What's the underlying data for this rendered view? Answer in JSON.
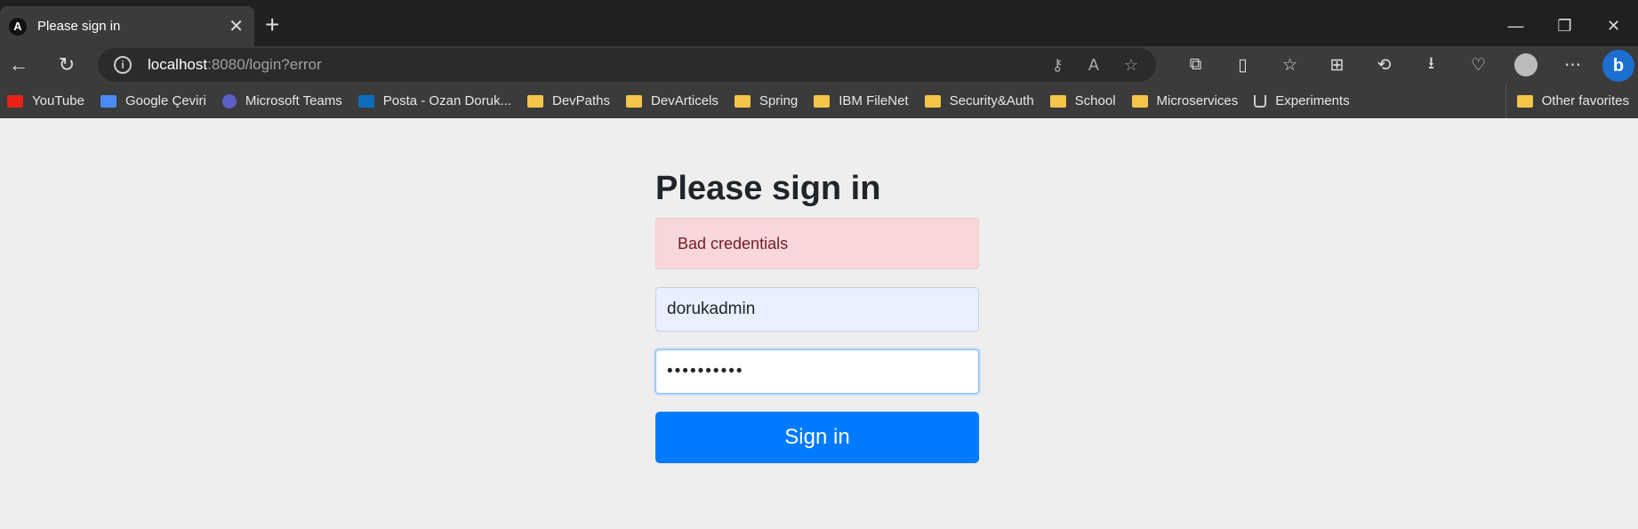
{
  "browser": {
    "tab_title": "Please sign in",
    "tab_favicon": "A",
    "new_tab": "+",
    "close_tab": "✕",
    "window_controls": [
      "—",
      "❐",
      "✕"
    ],
    "url_host": "localhost",
    "url_rest": ":8080/login?error",
    "bookmarks": [
      {
        "label": "YouTube",
        "icon": "youtube-icon"
      },
      {
        "label": "Google Çeviri",
        "icon": "google-translate-icon"
      },
      {
        "label": "Microsoft Teams",
        "icon": "teams-icon"
      },
      {
        "label": "Posta - Ozan Doruk...",
        "icon": "outlook-icon"
      },
      {
        "label": "DevPaths",
        "icon": "folder-icon"
      },
      {
        "label": "DevArticels",
        "icon": "folder-icon"
      },
      {
        "label": "Spring",
        "icon": "folder-icon"
      },
      {
        "label": "IBM FileNet",
        "icon": "folder-icon"
      },
      {
        "label": "Security&Auth",
        "icon": "folder-icon"
      },
      {
        "label": "School",
        "icon": "folder-icon"
      },
      {
        "label": "Microservices",
        "icon": "folder-icon"
      },
      {
        "label": "Experiments",
        "icon": "flask-icon"
      }
    ],
    "other_favorites": "Other favorites"
  },
  "page": {
    "heading": "Please sign in",
    "alert": "Bad credentials",
    "username_value": "dorukadmin",
    "password_value": "••••••••••",
    "submit_label": "Sign in"
  }
}
